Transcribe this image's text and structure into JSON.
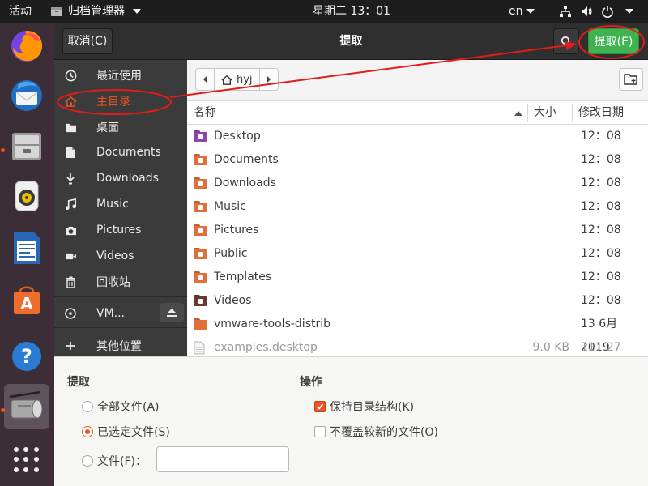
{
  "topbar": {
    "activities": "活动",
    "app_name": "归档管理器",
    "clock": "星期二 13：01",
    "lang": "en"
  },
  "dock": {
    "items": [
      {
        "icon": "firefox-icon"
      },
      {
        "icon": "thunderbird-icon"
      },
      {
        "icon": "files-icon"
      },
      {
        "icon": "rhythmbox-icon"
      },
      {
        "icon": "writer-icon"
      },
      {
        "icon": "software-center-icon"
      },
      {
        "icon": "help-icon"
      },
      {
        "icon": "archive-manager-icon"
      },
      {
        "icon": "show-apps-icon"
      }
    ]
  },
  "headerbar": {
    "cancel_label": "取消(C)",
    "title": "提取",
    "extract_label": "提取(E)"
  },
  "sidebar": {
    "items": [
      {
        "label": "最近使用",
        "icon": "clock-icon"
      },
      {
        "label": "主目录",
        "icon": "home-icon",
        "selected": true
      },
      {
        "label": "桌面",
        "icon": "folder-icon"
      },
      {
        "label": "Documents",
        "icon": "document-icon"
      },
      {
        "label": "Downloads",
        "icon": "download-icon"
      },
      {
        "label": "Music",
        "icon": "music-icon"
      },
      {
        "label": "Pictures",
        "icon": "camera-icon"
      },
      {
        "label": "Videos",
        "icon": "video-icon"
      },
      {
        "label": "回收站",
        "icon": "trash-icon"
      },
      {
        "label": "VM...",
        "icon": "disc-icon"
      },
      {
        "label": "其他位置",
        "icon": "plus-icon"
      }
    ]
  },
  "pathbar": {
    "current": "hyj"
  },
  "columns": {
    "name": "名称",
    "size": "大小",
    "modified": "修改日期"
  },
  "files": [
    {
      "name": "Desktop",
      "size": "",
      "modified": "12：08",
      "color": "#8e44ad",
      "emblem": "desktop"
    },
    {
      "name": "Documents",
      "size": "",
      "modified": "12：08",
      "color": "#e0703a",
      "emblem": "doc"
    },
    {
      "name": "Downloads",
      "size": "",
      "modified": "12：08",
      "color": "#e0703a",
      "emblem": "down"
    },
    {
      "name": "Music",
      "size": "",
      "modified": "12：08",
      "color": "#e0703a",
      "emblem": "music"
    },
    {
      "name": "Pictures",
      "size": "",
      "modified": "12：08",
      "color": "#e0703a",
      "emblem": "pic"
    },
    {
      "name": "Public",
      "size": "",
      "modified": "12：08",
      "color": "#e0703a",
      "emblem": "pub"
    },
    {
      "name": "Templates",
      "size": "",
      "modified": "12：08",
      "color": "#e0703a",
      "emblem": "tpl"
    },
    {
      "name": "Videos",
      "size": "",
      "modified": "12：08",
      "color": "#6b3a2e",
      "emblem": "vid"
    },
    {
      "name": "vmware-tools-distrib",
      "size": "",
      "modified": "13 6月 2019",
      "color": "#e0703a",
      "emblem": ""
    },
    {
      "name": "examples.desktop",
      "size": "9.0 KB",
      "modified": "11：27",
      "color": "#cfcfcf",
      "emblem": "file",
      "dimmed": true
    }
  ],
  "options": {
    "extract_heading": "提取",
    "all_files": "全部文件(A)",
    "selected_files": "已选定文件(S)",
    "files_label": "文件(F)：",
    "files_value": "",
    "action_heading": "操作",
    "keep_structure": "保持目录结构(K)",
    "no_overwrite": "不覆盖较新的文件(O)",
    "selected_radio": "selected_files",
    "keep_structure_checked": true,
    "no_overwrite_checked": false
  },
  "colors": {
    "accent": "#e95420",
    "extract_green": "#3eb34f",
    "annotation_red": "#e21b1b"
  }
}
